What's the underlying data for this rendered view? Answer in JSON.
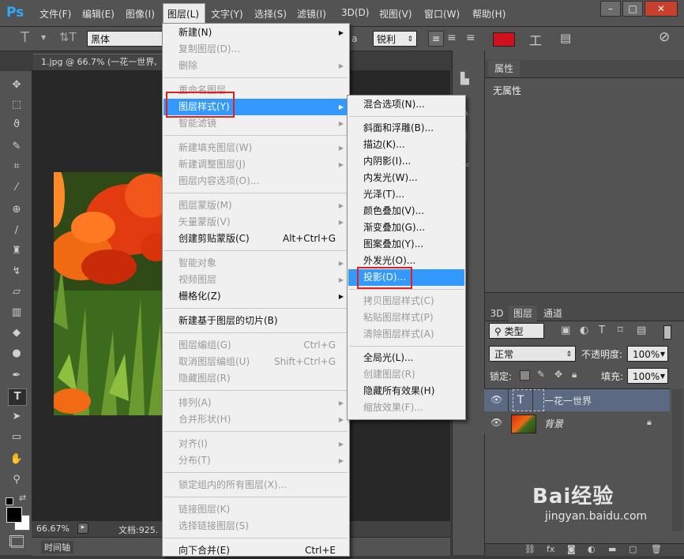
{
  "app": {
    "logo": "Ps"
  },
  "menubar": {
    "items": [
      "文件(F)",
      "编辑(E)",
      "图像(I)",
      "图层(L)",
      "文字(Y)",
      "选择(S)",
      "滤镜(I)",
      "3D(D)",
      "视图(V)",
      "窗口(W)",
      "帮助(H)"
    ],
    "window_buttons": [
      "–",
      "□",
      "✕"
    ]
  },
  "options": {
    "font_family": "黑体",
    "antialias": "锐利",
    "aa_label": "a",
    "color": "#d0101c"
  },
  "document": {
    "tab_title": "1.jpg @ 66.7% (一花一世界,",
    "zoom": "66.67%",
    "doc_info": "文档:925.",
    "timeline": "时间轴"
  },
  "layer_menu": {
    "items": [
      {
        "label": "新建(N)",
        "arrow": true,
        "disabled": false
      },
      {
        "label": "复制图层(D)...",
        "disabled": true
      },
      {
        "label": "删除",
        "arrow": true,
        "disabled": true
      },
      {
        "sep": true
      },
      {
        "label": "重命名图层...",
        "disabled": true
      },
      {
        "label": "图层样式(Y)",
        "arrow": true,
        "highlighted": true
      },
      {
        "label": "智能滤镜",
        "arrow": true,
        "disabled": true
      },
      {
        "sep": true
      },
      {
        "label": "新建填充图层(W)",
        "arrow": true,
        "disabled": true
      },
      {
        "label": "新建调整图层(J)",
        "arrow": true,
        "disabled": true
      },
      {
        "label": "图层内容选项(O)...",
        "disabled": true
      },
      {
        "sep": true
      },
      {
        "label": "图层蒙版(M)",
        "arrow": true,
        "disabled": true
      },
      {
        "label": "矢量蒙版(V)",
        "arrow": true,
        "disabled": true
      },
      {
        "label": "创建剪贴蒙版(C)",
        "shortcut": "Alt+Ctrl+G"
      },
      {
        "sep": true
      },
      {
        "label": "智能对象",
        "arrow": true,
        "disabled": true
      },
      {
        "label": "视频图层",
        "arrow": true,
        "disabled": true
      },
      {
        "label": "栅格化(Z)",
        "arrow": true
      },
      {
        "sep": true
      },
      {
        "label": "新建基于图层的切片(B)"
      },
      {
        "sep": true
      },
      {
        "label": "图层编组(G)",
        "shortcut": "Ctrl+G",
        "disabled": true
      },
      {
        "label": "取消图层编组(U)",
        "shortcut": "Shift+Ctrl+G",
        "disabled": true
      },
      {
        "label": "隐藏图层(R)",
        "disabled": true
      },
      {
        "sep": true
      },
      {
        "label": "排列(A)",
        "arrow": true,
        "disabled": true
      },
      {
        "label": "合并形状(H)",
        "arrow": true,
        "disabled": true
      },
      {
        "sep": true
      },
      {
        "label": "对齐(I)",
        "arrow": true,
        "disabled": true
      },
      {
        "label": "分布(T)",
        "arrow": true,
        "disabled": true
      },
      {
        "sep": true
      },
      {
        "label": "锁定组内的所有图层(X)...",
        "disabled": true
      },
      {
        "sep": true
      },
      {
        "label": "链接图层(K)",
        "disabled": true
      },
      {
        "label": "选择链接图层(S)",
        "disabled": true
      },
      {
        "sep": true
      },
      {
        "label": "向下合并(E)",
        "shortcut": "Ctrl+E"
      }
    ]
  },
  "style_menu": {
    "items": [
      {
        "label": "混合选项(N)..."
      },
      {
        "sep": true
      },
      {
        "label": "斜面和浮雕(B)..."
      },
      {
        "label": "描边(K)..."
      },
      {
        "label": "内阴影(I)..."
      },
      {
        "label": "内发光(W)..."
      },
      {
        "label": "光泽(T)..."
      },
      {
        "label": "颜色叠加(V)..."
      },
      {
        "label": "渐变叠加(G)..."
      },
      {
        "label": "图案叠加(Y)..."
      },
      {
        "label": "外发光(O)..."
      },
      {
        "label": "投影(D)...",
        "highlighted": true
      },
      {
        "sep": true
      },
      {
        "label": "拷贝图层样式(C)",
        "disabled": true
      },
      {
        "label": "粘贴图层样式(P)",
        "disabled": true
      },
      {
        "label": "清除图层样式(A)",
        "disabled": true
      },
      {
        "sep": true
      },
      {
        "label": "全局光(L)..."
      },
      {
        "label": "创建图层(R)",
        "disabled": true
      },
      {
        "label": "隐藏所有效果(H)"
      },
      {
        "label": "缩放效果(F)...",
        "disabled": true
      }
    ]
  },
  "properties": {
    "tab": "属性",
    "content": "无属性"
  },
  "layers_panel": {
    "tabs": [
      "3D",
      "图层",
      "通道"
    ],
    "filter": "类型",
    "blend": "正常",
    "opacity_label": "不透明度:",
    "opacity": "100%",
    "lock_label": "锁定:",
    "fill_label": "填充:",
    "fill": "100%",
    "layers": [
      {
        "name": "一花一世界",
        "type": "text",
        "selected": true
      },
      {
        "name": "背景",
        "type": "image",
        "locked": true
      }
    ]
  },
  "watermark": {
    "brand": "Bai经验",
    "url": "jingyan.baidu.com"
  }
}
